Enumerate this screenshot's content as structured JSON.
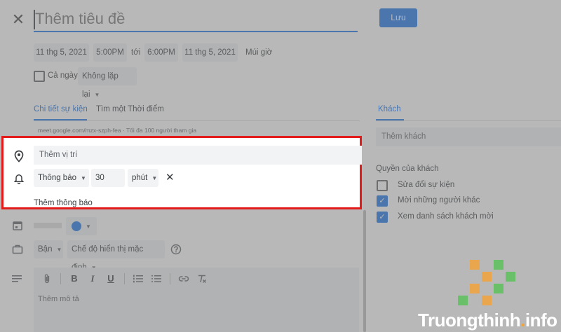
{
  "header": {
    "title_placeholder": "Thêm tiêu đề",
    "save_label": "Lưu"
  },
  "datetime": {
    "start_date": "11 thg 5, 2021",
    "start_time": "5:00PM",
    "to_label": "tới",
    "end_time": "6:00PM",
    "end_date": "11 thg 5, 2021",
    "timezone_label": "Múi giờ"
  },
  "options": {
    "all_day_label": "Cả ngày",
    "repeat_value": "Không lặp lại"
  },
  "tabs": {
    "details": "Chi tiết sự kiện",
    "find_time": "Tìm một Thời điểm",
    "guests": "Khách"
  },
  "meet": {
    "link_text": "meet.google.com/mzx-szph-fea · Tối đa 100 người tham gia"
  },
  "location": {
    "placeholder": "Thêm vị trí"
  },
  "notification": {
    "type": "Thông báo",
    "amount": "30",
    "unit": "phút",
    "add_label": "Thêm thông báo"
  },
  "calendar": {
    "color": "#1a73e8"
  },
  "status": {
    "busy": "Bận",
    "visibility": "Chế độ hiển thị mặc định"
  },
  "description": {
    "placeholder": "Thêm mô tả"
  },
  "guests": {
    "add_placeholder": "Thêm khách",
    "permissions_title": "Quyền của khách",
    "permissions": [
      {
        "label": "Sửa đổi sự kiện",
        "checked": false
      },
      {
        "label": "Mời những người khác",
        "checked": true
      },
      {
        "label": "Xem danh sách khách mời",
        "checked": true
      }
    ]
  },
  "watermark": {
    "brand": "Truongthinh",
    "dot": ".",
    "tld": "info"
  },
  "colors": {
    "accent": "#1a73e8",
    "highlight_border": "#e21a1a",
    "watermark_orange": "#f2a23a",
    "watermark_green": "#5cc05a"
  }
}
